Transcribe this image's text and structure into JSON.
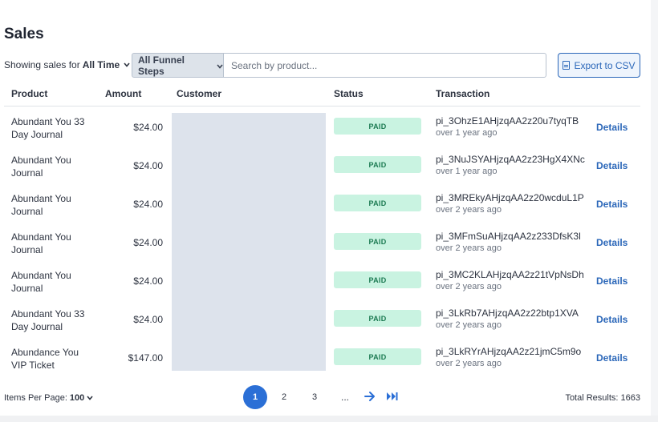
{
  "page_title": "Sales",
  "filters": {
    "showing_prefix": "Showing sales for",
    "time_range": "All Time",
    "funnel_select": "All Funnel Steps",
    "search_placeholder": "Search by product...",
    "export_label": "Export to CSV"
  },
  "table": {
    "columns": [
      "Product",
      "Amount",
      "Customer",
      "Status",
      "Transaction"
    ],
    "rows": [
      {
        "product": "Abundant You 33 Day Journal",
        "amount": "$24.00",
        "status": "PAID",
        "transaction_id": "pi_3OhzE1AHjzqAA2z20u7tyqTB",
        "time": "over 1 year ago",
        "action": "Details"
      },
      {
        "product": "Abundant You Journal",
        "amount": "$24.00",
        "status": "PAID",
        "transaction_id": "pi_3NuJSYAHjzqAA2z23HgX4XNc",
        "time": "over 1 year ago",
        "action": "Details"
      },
      {
        "product": "Abundant You Journal",
        "amount": "$24.00",
        "status": "PAID",
        "transaction_id": "pi_3MREkyAHjzqAA2z20wcduL1P",
        "time": "over 2 years ago",
        "action": "Details"
      },
      {
        "product": "Abundant You Journal",
        "amount": "$24.00",
        "status": "PAID",
        "transaction_id": "pi_3MFmSuAHjzqAA2z233DfsK3l",
        "time": "over 2 years ago",
        "action": "Details"
      },
      {
        "product": "Abundant You Journal",
        "amount": "$24.00",
        "status": "PAID",
        "transaction_id": "pi_3MC2KLAHjzqAA2z21tVpNsDh",
        "time": "over 2 years ago",
        "action": "Details"
      },
      {
        "product": "Abundant You 33 Day Journal",
        "amount": "$24.00",
        "status": "PAID",
        "transaction_id": "pi_3LkRb7AHjzqAA2z22btp1XVA",
        "time": "over 2 years ago",
        "action": "Details"
      },
      {
        "product": "Abundance You VIP Ticket",
        "amount": "$147.00",
        "status": "PAID",
        "transaction_id": "pi_3LkRYrAHjzqAA2z21jmC5m9o",
        "time": "over 2 years ago",
        "action": "Details"
      }
    ]
  },
  "footer": {
    "items_per_page_label": "Items Per Page:",
    "items_per_page_value": "100",
    "pages": [
      "1",
      "2",
      "3"
    ],
    "current_page": "1",
    "ellipsis": "...",
    "total_results": "Total Results: 1663"
  },
  "icons": {
    "time_range_chevron": "chevron-down-icon",
    "funnel_chevron": "chevron-down-icon",
    "export": "file-icon",
    "next": "arrow-right-icon",
    "last": "double-chevron-right-icon"
  },
  "colors": {
    "accent": "#2b6fd6",
    "link": "#2b67b9",
    "paid_bg": "#c9f3e1",
    "paid_text": "#1c7a52",
    "masked_customer": "#dde3ec"
  }
}
